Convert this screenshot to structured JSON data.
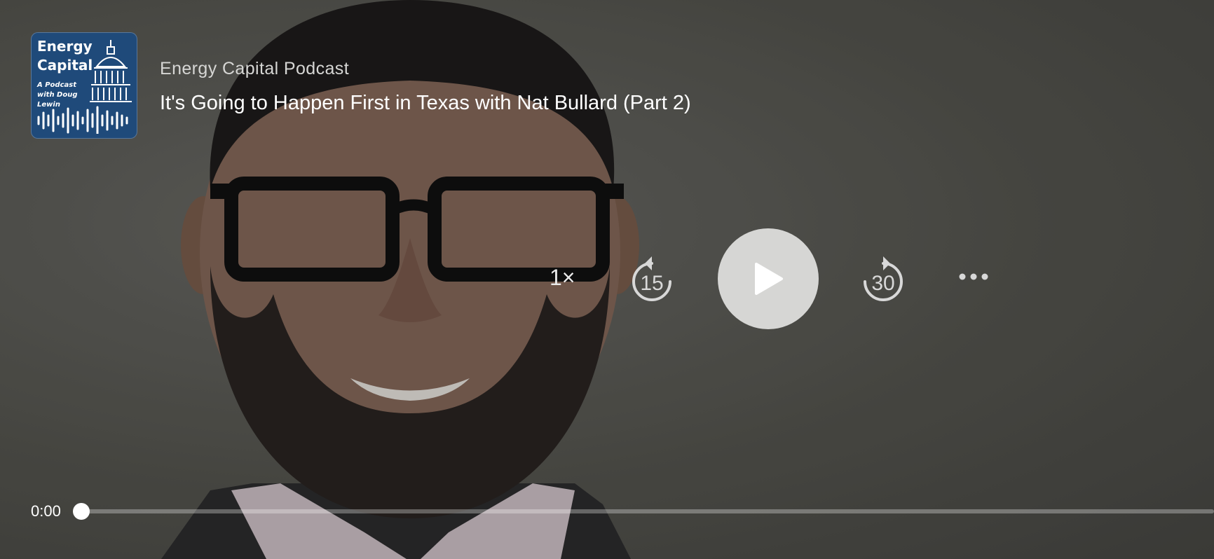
{
  "podcast": {
    "show_name": "Energy Capital Podcast",
    "episode_title": "It's Going to Happen First in Texas with Nat Bullard (Part 2)"
  },
  "artwork": {
    "title": "Energy Capital",
    "subtitle": "A Podcast with Doug Lewin",
    "background": "#1f4a7a"
  },
  "controls": {
    "speed_label": "1×",
    "skip_back_seconds": "15",
    "skip_forward_seconds": "30",
    "play_icon": "play-icon",
    "more_icon": "more-icon"
  },
  "progress": {
    "elapsed": "0:00",
    "fraction": 0.0
  },
  "colors": {
    "play_button": "#d6d6d4",
    "text": "#ffffff"
  }
}
